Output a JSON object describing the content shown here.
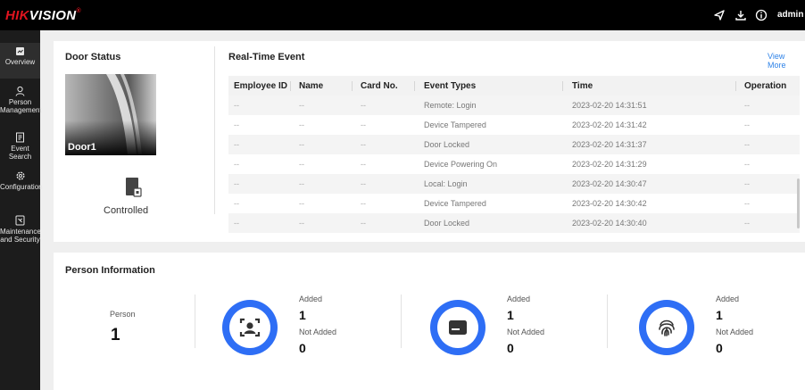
{
  "app": {
    "brand_prefix": "HIK",
    "brand_suffix": "VISION",
    "brand_mark": "®",
    "user": "admin",
    "topbar_icons": [
      "send-icon",
      "download-icon",
      "info-icon",
      "chevron-down-icon"
    ]
  },
  "sidebar": {
    "items": [
      {
        "label_lines": [
          "Overview"
        ],
        "icon": "overview-icon",
        "active": true
      },
      {
        "label_lines": [
          "Person",
          "Management"
        ],
        "icon": "person-icon",
        "active": false
      },
      {
        "label_lines": [
          "Event Search"
        ],
        "icon": "event-search-icon",
        "active": false
      },
      {
        "label_lines": [
          "Configuration"
        ],
        "icon": "gear-icon",
        "active": false
      },
      {
        "label_lines": [
          "Maintenance",
          "and Security"
        ],
        "icon": "maintenance-icon",
        "active": false
      }
    ]
  },
  "door_status": {
    "title": "Door Status",
    "door_name": "Door1",
    "state": "Controlled"
  },
  "realtime": {
    "title": "Real-Time Event",
    "view_more": "View More",
    "columns": [
      "Employee ID",
      "Name",
      "Card No.",
      "Event Types",
      "Time",
      "Operation"
    ],
    "rows": [
      [
        "--",
        "--",
        "--",
        "Remote: Login",
        "2023-02-20 14:31:51",
        "--"
      ],
      [
        "--",
        "--",
        "--",
        "Device Tampered",
        "2023-02-20 14:31:42",
        "--"
      ],
      [
        "--",
        "--",
        "--",
        "Door Locked",
        "2023-02-20 14:31:37",
        "--"
      ],
      [
        "--",
        "--",
        "--",
        "Device Powering On",
        "2023-02-20 14:31:29",
        "--"
      ],
      [
        "--",
        "--",
        "--",
        "Local: Login",
        "2023-02-20 14:30:47",
        "--"
      ],
      [
        "--",
        "--",
        "--",
        "Device Tampered",
        "2023-02-20 14:30:42",
        "--"
      ],
      [
        "--",
        "--",
        "--",
        "Door Locked",
        "2023-02-20 14:30:40",
        "--"
      ]
    ]
  },
  "person_info": {
    "title": "Person Information",
    "person_label": "Person",
    "person_count": "1",
    "added_label": "Added",
    "not_added_label": "Not Added",
    "groups": [
      {
        "icon": "face-icon",
        "added": "1",
        "not_added": "0"
      },
      {
        "icon": "card-icon",
        "added": "1",
        "not_added": "0"
      },
      {
        "icon": "fingerprint-icon",
        "added": "1",
        "not_added": "0"
      }
    ]
  },
  "colors": {
    "accent": "#2e6ef5",
    "brand_red": "#e0141f",
    "link": "#2f83e8"
  }
}
